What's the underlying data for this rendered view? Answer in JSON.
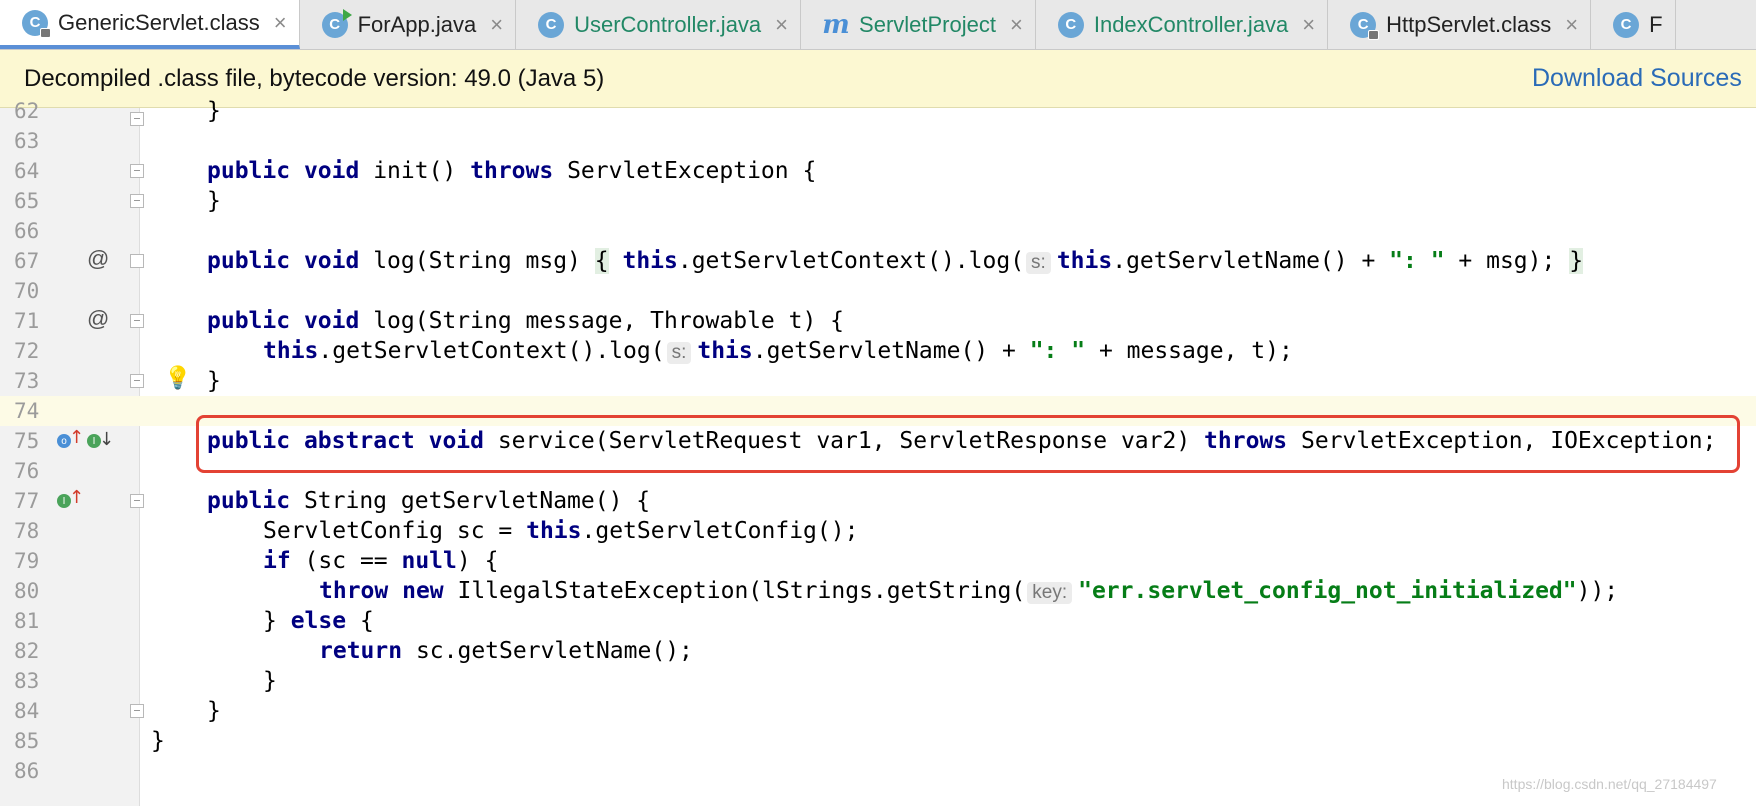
{
  "tabs": [
    {
      "label": "GenericServlet.class",
      "icon": "class-locked-icon",
      "active": true
    },
    {
      "label": "ForApp.java",
      "icon": "class-run-icon"
    },
    {
      "label": "UserController.java",
      "icon": "class-icon",
      "teal": true
    },
    {
      "label": "ServletProject",
      "icon": "maven-m-icon",
      "teal": true
    },
    {
      "label": "IndexController.java",
      "icon": "class-icon",
      "teal": true
    },
    {
      "label": "HttpServlet.class",
      "icon": "class-locked-icon"
    },
    {
      "label": "F",
      "icon": "class-icon"
    }
  ],
  "tab_icon_letter": "C",
  "tab_maven_letter": "m",
  "tab_close_glyph": "×",
  "notice": {
    "text": "Decompiled .class file, bytecode version: 49.0 (Java 5)",
    "link": "Download Sources"
  },
  "gutter": {
    "at_symbol": "@",
    "bulb_glyph": "💡",
    "impl_icon_letter": "I",
    "override_icon_letter": "o",
    "arrow_up": "↑",
    "arrow_down": "↓"
  },
  "lines": {
    "n62": "62",
    "n63": "63",
    "n64": "64",
    "n65": "65",
    "n66": "66",
    "n67": "67",
    "n70": "70",
    "n71": "71",
    "n72": "72",
    "n73": "73",
    "n74": "74",
    "n75": "75",
    "n76": "76",
    "n77": "77",
    "n78": "78",
    "n79": "79",
    "n80": "80",
    "n81": "81",
    "n82": "82",
    "n83": "83",
    "n84": "84",
    "n85": "85",
    "n86": "86"
  },
  "code": {
    "k_public": "public",
    "k_void": "void",
    "k_throws": "throws",
    "k_this": "this",
    "k_abstract": "abstract",
    "k_if": "if",
    "k_null": "null",
    "k_throw": "throw",
    "k_new": "new",
    "k_else": "else",
    "k_return": "return",
    "close_brace": "}",
    "open_brace": "{",
    "l64_a": " init() ",
    "l64_b": " ServletException {",
    "l67_a": " log(String msg) ",
    "l67_b": ".getServletContext().log(",
    "hint_s": "s:",
    "l67_c": ".getServletName() + ",
    "str_colon": "\": \"",
    "l67_d": " + msg); ",
    "l71_a": " log(String message, Throwable t) {",
    "l72_a": ".getServletContext().log(",
    "l72_b": ".getServletName() + ",
    "l72_c": " + message, t);",
    "l75_a": " service(ServletRequest var1, ServletResponse var2) ",
    "l75_b": " ServletException, IOException;",
    "l77_a": " String getServletName() {",
    "l78_a": "ServletConfig sc = ",
    "l78_b": ".getServletConfig();",
    "l79_a": " (sc == ",
    "l79_b": ") {",
    "l80_a": " IllegalStateException(lStrings.getString(",
    "hint_key": "key:",
    "str_err": "\"err.servlet_config_not_initialized\"",
    "l80_b": "));",
    "l81_a": "} ",
    "l81_b": " {",
    "l82_a": " sc.getServletName();"
  },
  "watermark": "https://blog.csdn.net/qq_27184497",
  "colors": {
    "keyword": "#000080",
    "string": "#067d17",
    "highlight_box": "#e34234",
    "notice_bg": "#fcf8d2"
  }
}
